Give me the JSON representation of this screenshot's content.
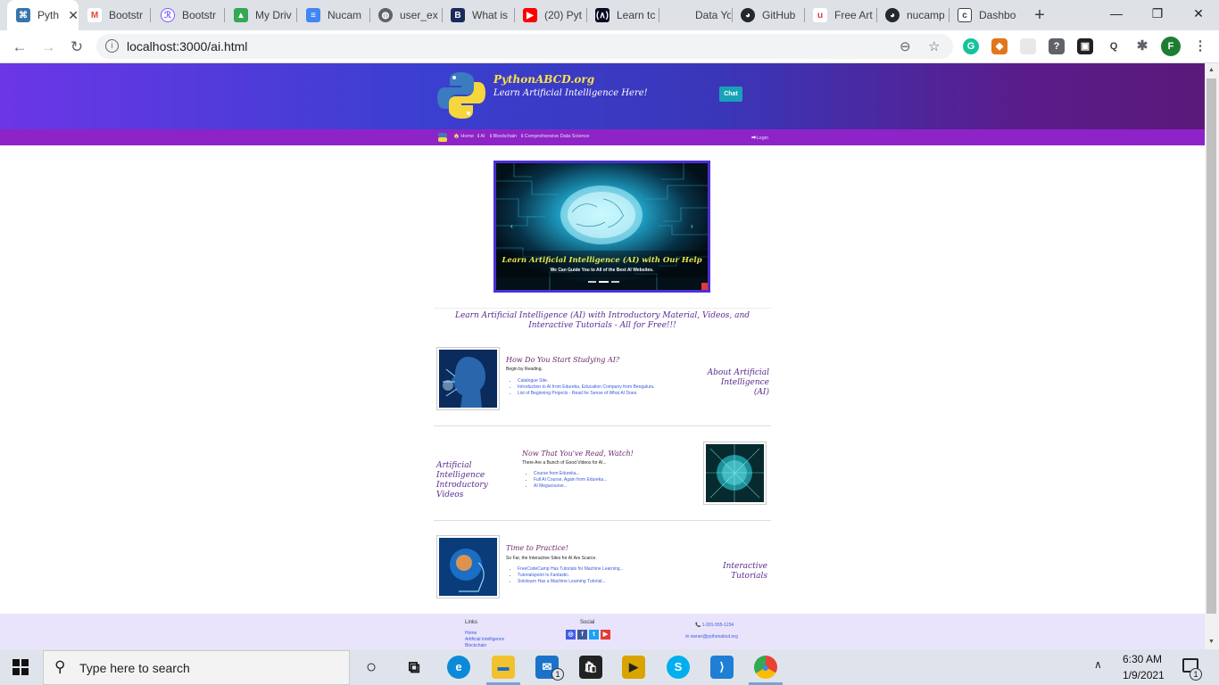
{
  "browser": {
    "tabs": [
      {
        "label": "Pyth",
        "color": "#3776ab",
        "glyph": "python-icon",
        "active": true
      },
      {
        "label": "Bootstr",
        "color": "#ea4335",
        "glyph": "gmail-icon"
      },
      {
        "label": "Bootstr",
        "color": "#7a5af8",
        "glyph": "bootstrap-icon"
      },
      {
        "label": "My Driv",
        "color": "#34a853",
        "glyph": "drive-icon"
      },
      {
        "label": "Nucam",
        "color": "#4285f4",
        "glyph": "docs-icon"
      },
      {
        "label": "user_ex",
        "color": "#5f6368",
        "glyph": "globe-icon"
      },
      {
        "label": "What is",
        "color": "#1a2b5a",
        "glyph": "b-icon"
      },
      {
        "label": "(20) Pyt",
        "color": "#ff0000",
        "glyph": "youtube-icon"
      },
      {
        "label": "Learn tc",
        "color": "#0a0a23",
        "glyph": "freecodecamp-icon"
      },
      {
        "label": "Data Yo",
        "color": "#ffffff",
        "glyph": "blank-icon"
      },
      {
        "label": "GitHub",
        "color": "#24292e",
        "glyph": "github-icon"
      },
      {
        "label": "Free Art",
        "color": "#e8324b",
        "glyph": "u-icon"
      },
      {
        "label": "nucamp",
        "color": "#24292e",
        "glyph": "github-icon"
      },
      {
        "label": "Dashbo",
        "color": "#3c4043",
        "glyph": "dashboard-icon"
      }
    ],
    "close_glyph": "✕",
    "new_tab_glyph": "+",
    "window_controls": [
      "—",
      "❐",
      "✕"
    ],
    "nav": {
      "back": "←",
      "forward": "→",
      "reload": "↻"
    },
    "url": "localhost:3000/ai.html",
    "info_glyph": "i",
    "zoom_glyph": "⊖",
    "star_glyph": "☆",
    "extensions": [
      {
        "name": "grammarly-icon",
        "glyph": "G",
        "color": "#15c39a"
      },
      {
        "name": "metamask-icon",
        "glyph": "◆",
        "color": "#e2761b"
      },
      {
        "name": "blank-ext-icon",
        "glyph": "",
        "color": "#e8e8e8"
      },
      {
        "name": "help-ext-icon",
        "glyph": "?",
        "color": "#5f6368"
      },
      {
        "name": "dev-ext-icon",
        "glyph": "▣",
        "color": "#202124"
      },
      {
        "name": "search-ext-icon",
        "glyph": "Q",
        "color": "#3c4043"
      },
      {
        "name": "puzzle-icon",
        "glyph": "✱",
        "color": "#5f6368"
      },
      {
        "name": "profile-avatar",
        "glyph": "F",
        "color": "#1e7d32"
      },
      {
        "name": "menu-icon",
        "glyph": "⋮",
        "color": "#5f6368"
      }
    ]
  },
  "site": {
    "brand": "PythonABCD.org",
    "tagline": "Learn Artificial Intelligence Here!",
    "chat_label": "Chat",
    "nav": [
      {
        "label": "🏠 Home"
      },
      {
        "label": "ℹ AI"
      },
      {
        "label": "ℹ Blockchain"
      },
      {
        "label": "ℹ Comprehensive Data Science"
      }
    ],
    "login_label": "⮕Login",
    "carousel": {
      "title": "Learn Artificial Intelligence (AI) with Our Help",
      "subtitle": "We Can Guide You to All of the Best AI Websites.",
      "prev": "‹",
      "next": "›"
    },
    "intro": "Learn Artificial Intelligence (AI) with Introductory Material, Videos, and Interactive Tutorials - All for Free!!!",
    "sections": [
      {
        "title": "How Do You Start Studying AI?",
        "subtitle": "Begin by Reading.",
        "links": [
          "Catalogue Site.",
          "Introduction to AI from Edureka, Education Company from Bengaluru.",
          "List of Beginning Projects - Read for Sense of What AI Does."
        ],
        "side": "About Artificial Intelligence (AI)"
      },
      {
        "title": "Now That You've Read, Watch!",
        "subtitle": "There Are a Bunch of Good Videos for AI...",
        "links": [
          "Course from Edureka...",
          "Full AI Course, Again from Edureka...",
          "AI Megacourse..."
        ],
        "side": "Artificial Intelligence Introductory Videos"
      },
      {
        "title": "Time to Practice!",
        "subtitle": "So Far, the Interactive Sites for AI Are Scarce.",
        "links": [
          "FreeCodeCamp Has Tutorials for Machine Learning...",
          "Tutorialspoint Is Fantastic.",
          "Sololearn Has a Machine Learning Tutorial..."
        ],
        "side": "Interactive Tutorials"
      }
    ],
    "footer": {
      "links_heading": "Links",
      "links": [
        "Home",
        "Artificial Intelligence",
        "Blockchain"
      ],
      "social_heading": "Social",
      "social": [
        {
          "name": "instagram-icon",
          "glyph": "◎",
          "color": "#405de6"
        },
        {
          "name": "facebook-icon",
          "glyph": "f",
          "color": "#3b5998"
        },
        {
          "name": "twitter-icon",
          "glyph": "t",
          "color": "#1da1f2"
        },
        {
          "name": "youtube-icon",
          "glyph": "▶",
          "color": "#e53935"
        }
      ],
      "phone": "📞 1-301-555-1234",
      "email": "✉ owner@pythonabcd.org"
    }
  },
  "taskbar": {
    "search_placeholder": "Type here to search",
    "search_glyph": "⚲",
    "apps": [
      {
        "name": "cortana-icon",
        "glyph": "○",
        "color": "transparent",
        "fg": "#111"
      },
      {
        "name": "task-view-icon",
        "glyph": "⧉",
        "color": "transparent",
        "fg": "#111"
      },
      {
        "name": "edge-icon",
        "glyph": "e",
        "color": "#0c8ad8",
        "fg": "#fff"
      },
      {
        "name": "file-explorer-icon",
        "glyph": "▬",
        "color": "#f2c12e",
        "fg": "#1a6fc9"
      },
      {
        "name": "mail-icon",
        "glyph": "✉",
        "color": "#1a73c8",
        "fg": "#fff"
      },
      {
        "name": "store-icon",
        "glyph": "🛍",
        "color": "#222",
        "fg": "#fff"
      },
      {
        "name": "video-icon",
        "glyph": "▶",
        "color": "#d9a400",
        "fg": "#222"
      },
      {
        "name": "skype-icon",
        "glyph": "S",
        "color": "#00aff0",
        "fg": "#fff"
      },
      {
        "name": "vscode-icon",
        "glyph": "⟩",
        "color": "#1f7fd4",
        "fg": "#fff"
      },
      {
        "name": "chrome-icon",
        "glyph": "●",
        "color": "#e94235",
        "fg": "#4285f4"
      }
    ],
    "mail_badge": "1",
    "tray_arrow": "∧",
    "time": "6:30 AM",
    "date": "1/9/2021",
    "notif_badge": "1"
  }
}
